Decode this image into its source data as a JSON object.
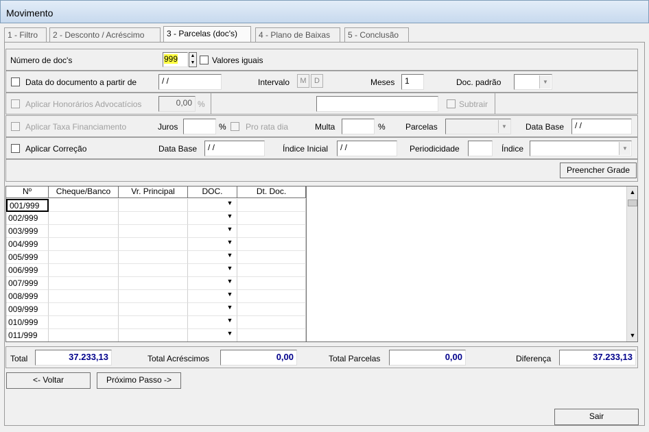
{
  "window": {
    "title": "Movimento"
  },
  "tabs": [
    {
      "label": "1 - Filtro",
      "active": false
    },
    {
      "label": "2 - Desconto / Acréscimo",
      "active": false
    },
    {
      "label": "3 - Parcelas (doc's)",
      "active": true
    },
    {
      "label": "4 - Plano de Baixas",
      "active": false
    },
    {
      "label": "5 - Conclusão",
      "active": false
    }
  ],
  "numero_docs": {
    "label": "Número de doc's",
    "value": "999",
    "valores_iguais_label": "Valores iguais"
  },
  "data_doc": {
    "label": "Data do documento a partir de",
    "value": "/ /",
    "intervalo_label": "Intervalo",
    "intervalo_m": "M",
    "intervalo_d": "D",
    "meses_label": "Meses",
    "meses_value": "1",
    "doc_padrao_label": "Doc. padrão",
    "doc_padrao_value": ""
  },
  "honorarios": {
    "label": "Aplicar Honorários Advocatícios",
    "value": "0,00",
    "unit": "%",
    "text_value": "",
    "subtrair_label": "Subtrair"
  },
  "financiamento": {
    "label": "Aplicar Taxa Financiamento",
    "juros_label": "Juros",
    "juros_value": "",
    "juros_unit": "%",
    "pro_rata_label": "Pro rata dia",
    "multa_label": "Multa",
    "multa_value": "",
    "multa_unit": "%",
    "parcelas_label": "Parcelas",
    "parcelas_value": "",
    "data_base_label": "Data Base",
    "data_base_value": "/ /"
  },
  "correcao": {
    "label": "Aplicar Correção",
    "data_base_label": "Data Base",
    "data_base_value": "/ /",
    "indice_inicial_label": "Índice Inicial",
    "indice_inicial_value": "/ /",
    "periodicidade_label": "Periodicidade",
    "periodicidade_value": "",
    "indice_label": "Índice",
    "indice_value": ""
  },
  "preencher_label": "Preencher Grade",
  "grid": {
    "headers": [
      "Nº",
      "Cheque/Banco",
      "Vr. Principal",
      "DOC.",
      "Dt. Doc."
    ],
    "rows": [
      "001/999",
      "002/999",
      "003/999",
      "004/999",
      "005/999",
      "006/999",
      "007/999",
      "008/999",
      "009/999",
      "010/999",
      "011/999"
    ]
  },
  "totals": {
    "total_label": "Total",
    "total_value": "37.233,13",
    "acrescimos_label": "Total Acréscimos",
    "acrescimos_value": "0,00",
    "parcelas_label": "Total Parcelas",
    "parcelas_value": "0,00",
    "diferenca_label": "Diferença",
    "diferenca_value": "37.233,13"
  },
  "buttons": {
    "voltar": "<- Voltar",
    "proximo": "Próximo Passo ->",
    "sair": "Sair"
  }
}
